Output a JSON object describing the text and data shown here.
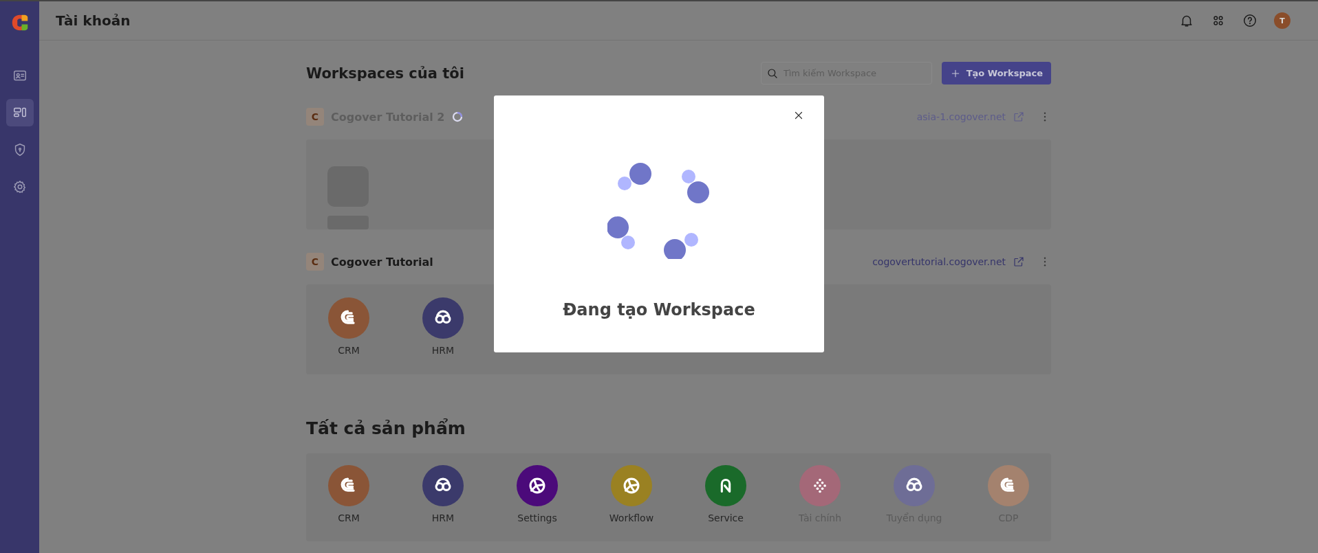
{
  "sidebar": {
    "items": [
      {
        "kind": "contact",
        "selected": false
      },
      {
        "kind": "dashboard",
        "selected": true
      },
      {
        "kind": "shield",
        "selected": false
      },
      {
        "kind": "gear",
        "selected": false
      }
    ]
  },
  "header": {
    "title": "Tài khoản",
    "avatar": "T"
  },
  "workspaces": {
    "title": "Workspaces của tôi",
    "search": {
      "placeholder": "Tìm kiếm Workspace"
    },
    "create_button": "Tạo Workspace",
    "items": [
      {
        "initial": "C",
        "name": "Cogover Tutorial 2",
        "loading": true,
        "url": "asia-1.cogover.net"
      },
      {
        "initial": "C",
        "name": "Cogover Tutorial",
        "loading": false,
        "url": "cogovertutorial.cogover.net",
        "apps": [
          {
            "kind": "crm",
            "label": "CRM",
            "color": "#8a5537",
            "disabled": false
          },
          {
            "kind": "hrm",
            "label": "HRM",
            "color": "#3b3a6b",
            "disabled": false
          }
        ]
      }
    ]
  },
  "products": {
    "title": "Tất cả sản phẩm",
    "items": [
      {
        "kind": "crm",
        "label": "CRM",
        "color": "#8a5537",
        "disabled": false
      },
      {
        "kind": "hrm",
        "label": "HRM",
        "color": "#3b3a6b",
        "disabled": false
      },
      {
        "kind": "aperture",
        "label": "Settings",
        "color": "#4b0a7a",
        "disabled": false
      },
      {
        "kind": "aperture",
        "label": "Workflow",
        "color": "#9a8122",
        "disabled": false
      },
      {
        "kind": "service",
        "label": "Service",
        "color": "#1a6a2a",
        "disabled": false
      },
      {
        "kind": "dots",
        "label": "Tài chính",
        "color": "#a46878",
        "disabled": true
      },
      {
        "kind": "hrm",
        "label": "Tuyển dụng",
        "color": "#6e6d96",
        "disabled": true
      },
      {
        "kind": "crm",
        "label": "CDP",
        "color": "#a4826e",
        "disabled": true
      }
    ]
  },
  "modal": {
    "title": "Đang tạo Workspace"
  }
}
